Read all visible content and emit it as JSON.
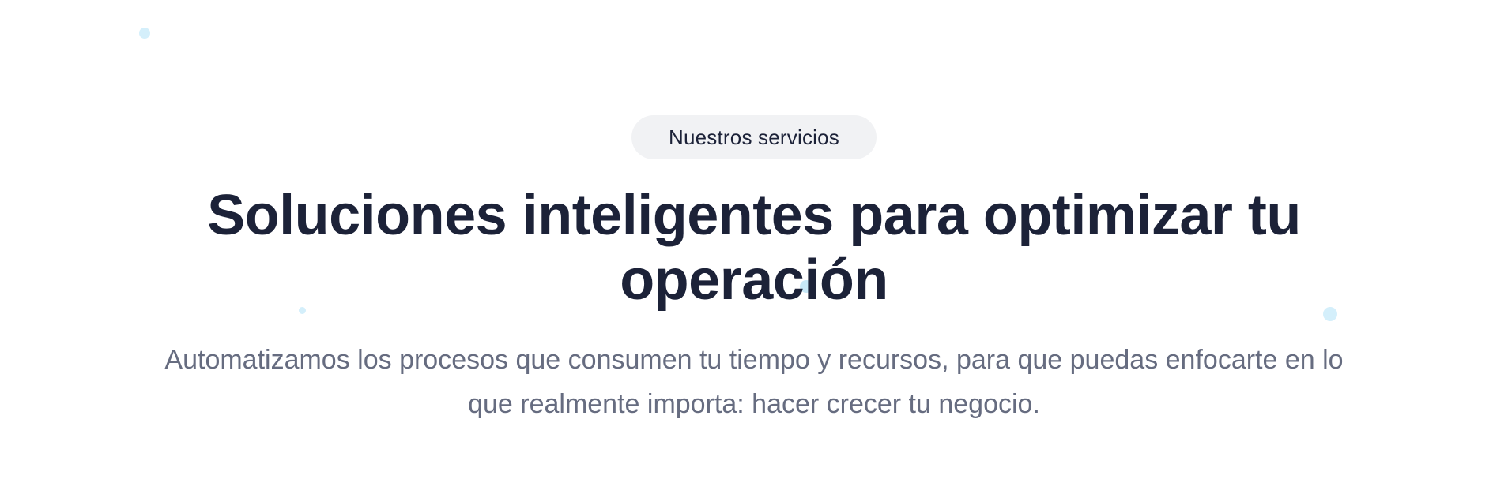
{
  "section": {
    "badge": "Nuestros servicios",
    "title": "Soluciones inteligentes para optimizar tu operación",
    "subtitle": "Automatizamos los procesos que consumen tu tiempo y recursos, para que puedas enfocarte en lo que realmente importa: hacer crecer tu negocio."
  },
  "colors": {
    "title": "#1c2238",
    "subtitle": "#666c80",
    "badge_bg": "#f1f2f4",
    "dots": "#d4effb"
  }
}
